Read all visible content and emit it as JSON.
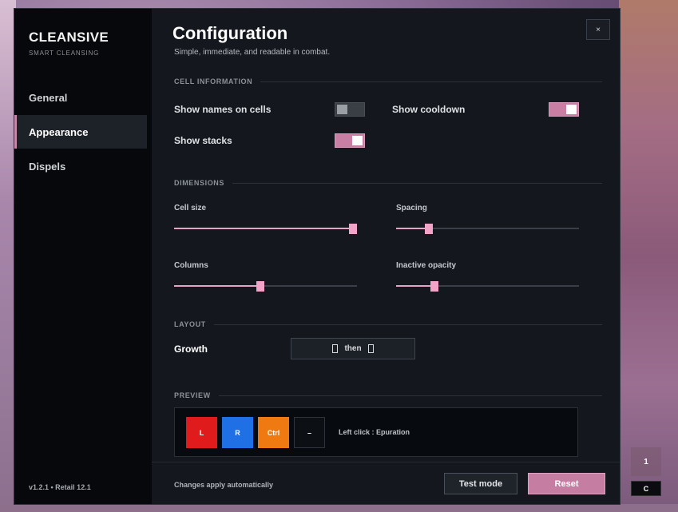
{
  "brand": {
    "name": "CLEANSIVE",
    "tagline": "SMART CLEANSING"
  },
  "nav": [
    {
      "label": "General",
      "active": false
    },
    {
      "label": "Appearance",
      "active": true
    },
    {
      "label": "Dispels",
      "active": false
    }
  ],
  "version": "v1.2.1  •  Retail 12.1",
  "header": {
    "title": "Configuration",
    "subtitle": "Simple, immediate, and readable in combat.",
    "close": "×"
  },
  "sections": {
    "cell_info": "CELL INFORMATION",
    "dimensions": "DIMENSIONS",
    "layout": "LAYOUT",
    "preview": "PREVIEW"
  },
  "cell_info": {
    "show_names": {
      "label": "Show names on cells",
      "on": false
    },
    "show_cooldown": {
      "label": "Show cooldown",
      "on": true
    },
    "show_stacks": {
      "label": "Show stacks",
      "on": true
    }
  },
  "dimensions": {
    "cell_size": {
      "label": "Cell size",
      "fraction": 0.98
    },
    "spacing": {
      "label": "Spacing",
      "fraction": 0.18
    },
    "columns": {
      "label": "Columns",
      "fraction": 0.47
    },
    "inactive_opacity": {
      "label": "Inactive opacity",
      "fraction": 0.21
    }
  },
  "layout": {
    "growth_label": "Growth",
    "growth_value": "then"
  },
  "preview": {
    "cells": [
      {
        "label": "L",
        "color": "#e01b1b"
      },
      {
        "label": "R",
        "color": "#1f6fe5"
      },
      {
        "label": "Ctrl",
        "color": "#f07a12"
      },
      {
        "label": "–",
        "color": "#0c0f13"
      }
    ],
    "text": "Left click : Epuration"
  },
  "footer": {
    "note": "Changes apply automatically",
    "test_mode": "Test mode",
    "reset": "Reset"
  },
  "external": {
    "badge": "1",
    "key": "C"
  },
  "colors": {
    "accent": "#c97ea3",
    "panel": "#14181e",
    "sidebar": "#06080b"
  }
}
